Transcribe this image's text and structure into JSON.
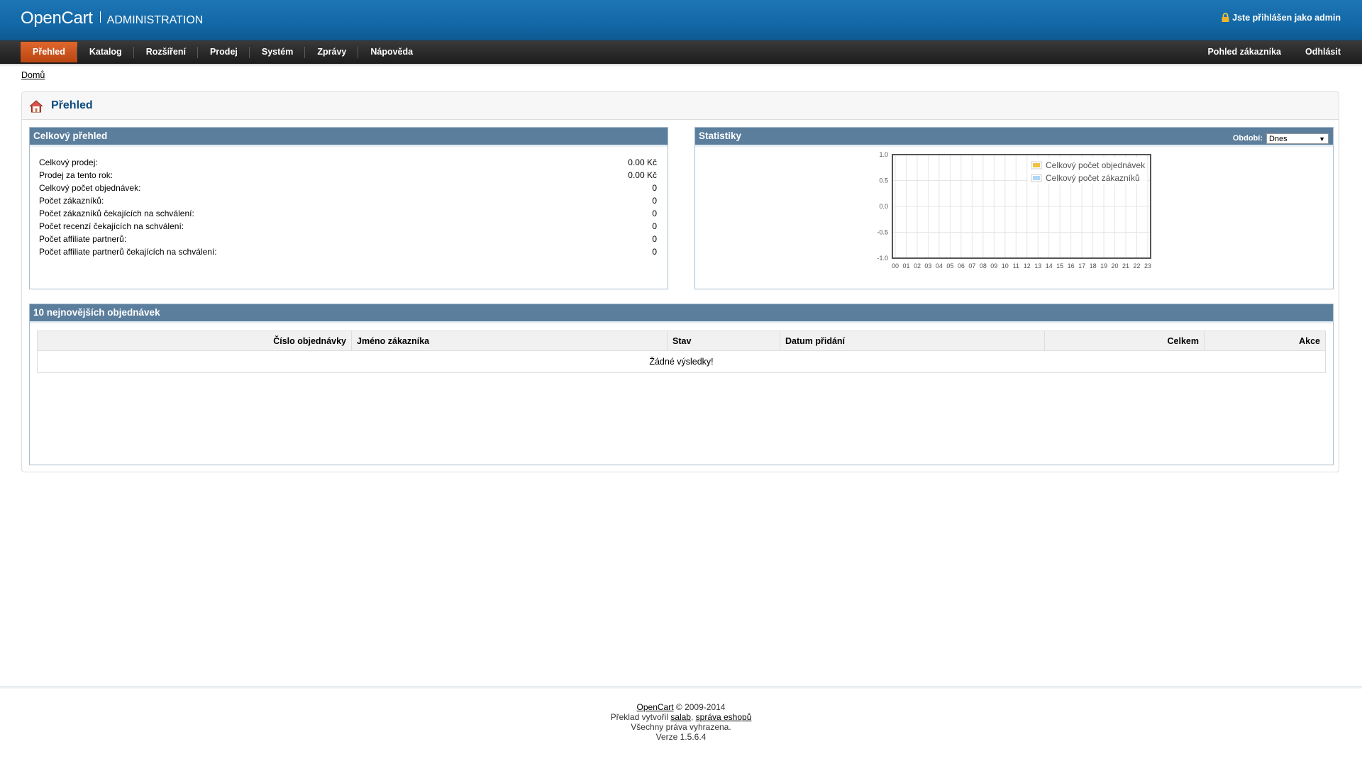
{
  "header": {
    "brand": "OpenCart",
    "subtitle": "ADMINISTRATION",
    "login_text": "Jste přihlášen jako admin"
  },
  "menu": {
    "items": [
      {
        "label": "Přehled",
        "active": true
      },
      {
        "label": "Katalog"
      },
      {
        "label": "Rozšíření"
      },
      {
        "label": "Prodej"
      },
      {
        "label": "Systém"
      },
      {
        "label": "Zprávy"
      },
      {
        "label": "Nápověda"
      }
    ],
    "right": [
      {
        "label": "Pohled zákazníka"
      },
      {
        "label": "Odhlásit"
      }
    ]
  },
  "breadcrumb": {
    "home": "Domů"
  },
  "page": {
    "title": "Přehled"
  },
  "overview": {
    "title": "Celkový přehled",
    "rows": [
      {
        "label": "Celkový prodej:",
        "value": "0.00 Kč"
      },
      {
        "label": "Prodej za tento rok:",
        "value": "0.00 Kč"
      },
      {
        "label": "Celkový počet objednávek:",
        "value": "0"
      },
      {
        "label": "Počet zákazníků:",
        "value": "0"
      },
      {
        "label": "Počet zákazníků čekajících na schválení:",
        "value": "0"
      },
      {
        "label": "Počet recenzí čekajících na schválení:",
        "value": "0"
      },
      {
        "label": "Počet affiliate partnerů:",
        "value": "0"
      },
      {
        "label": "Počet affiliate partnerů čekajících na schválení:",
        "value": "0"
      }
    ]
  },
  "stats": {
    "title": "Statistiky",
    "period_label": "Období:",
    "period_value": "Dnes"
  },
  "chart_data": {
    "type": "line",
    "x": [
      "00",
      "01",
      "02",
      "03",
      "04",
      "05",
      "06",
      "07",
      "08",
      "09",
      "10",
      "11",
      "12",
      "13",
      "14",
      "15",
      "16",
      "17",
      "18",
      "19",
      "20",
      "21",
      "22",
      "23"
    ],
    "series": [
      {
        "name": "Celkový počet objednávek",
        "color": "#edc240",
        "values": []
      },
      {
        "name": "Celkový počet zákazníků",
        "color": "#afd8f8",
        "values": []
      }
    ],
    "yticks": [
      "1.0",
      "0.5",
      "0.0",
      "-0.5",
      "-1.0"
    ],
    "ylim": [
      -1,
      1
    ],
    "grid": true,
    "legend": "top-right"
  },
  "latest": {
    "title": "10 nejnovějších objednávek",
    "columns": [
      "Číslo objednávky",
      "Jméno zákazníka",
      "Stav",
      "Datum přidání",
      "Celkem",
      "Akce"
    ],
    "empty": "Žádné výsledky!"
  },
  "footer": {
    "opencart_link": "OpenCart",
    "copyright": " © 2009-2014",
    "translation_prefix": "Překlad vytvořil ",
    "translator1": "salab",
    "comma": ", ",
    "translator2": "správa eshopů",
    "rights": "Všechny práva vyhrazena.",
    "version": "Verze 1.5.6.4"
  }
}
